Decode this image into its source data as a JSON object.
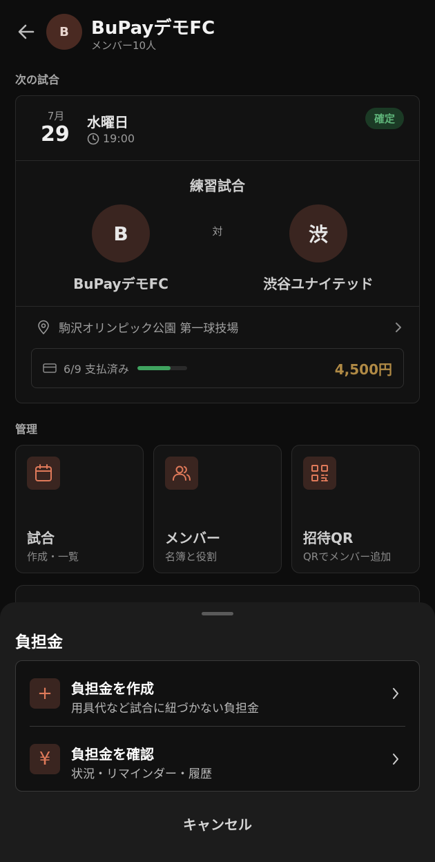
{
  "header": {
    "avatar_letter": "B",
    "team_name": "BuPayデモFC",
    "member_count": "メンバー10人"
  },
  "next_match": {
    "section_label": "次の試合",
    "month": "7月",
    "day": "29",
    "weekday": "水曜日",
    "time": "19:00",
    "status_badge": "確定",
    "match_type": "練習試合",
    "vs_label": "対",
    "home_team": {
      "initial": "B",
      "name": "BuPayデモFC"
    },
    "away_team": {
      "initial": "渋",
      "name": "渋谷ユナイテッド"
    },
    "venue": "駒沢オリンピック公園 第一球技場",
    "payment": {
      "status_text": "6/9 支払済み",
      "progress_fraction": 0.667,
      "amount": "4,500円"
    }
  },
  "management": {
    "section_label": "管理",
    "tiles": [
      {
        "title": "試合",
        "subtitle": "作成・一覧",
        "icon": "calendar-icon"
      },
      {
        "title": "メンバー",
        "subtitle": "名簿と役割",
        "icon": "users-icon"
      },
      {
        "title": "招待QR",
        "subtitle": "QRでメンバー追加",
        "icon": "qr-code-icon"
      }
    ]
  },
  "sheet": {
    "title": "負担金",
    "options": [
      {
        "title": "負担金を作成",
        "subtitle": "用具代など試合に紐づかない負担金",
        "icon": "plus-icon",
        "glyph": "+"
      },
      {
        "title": "負担金を確認",
        "subtitle": "状況・リマインダー・履歴",
        "icon": "yen-icon",
        "glyph": "¥"
      }
    ],
    "cancel_label": "キャンセル"
  },
  "colors": {
    "accent": "#e07a5a",
    "confirmed_badge": "#5fb57a",
    "amount": "#b08a45",
    "progress": "#3fa35f"
  }
}
